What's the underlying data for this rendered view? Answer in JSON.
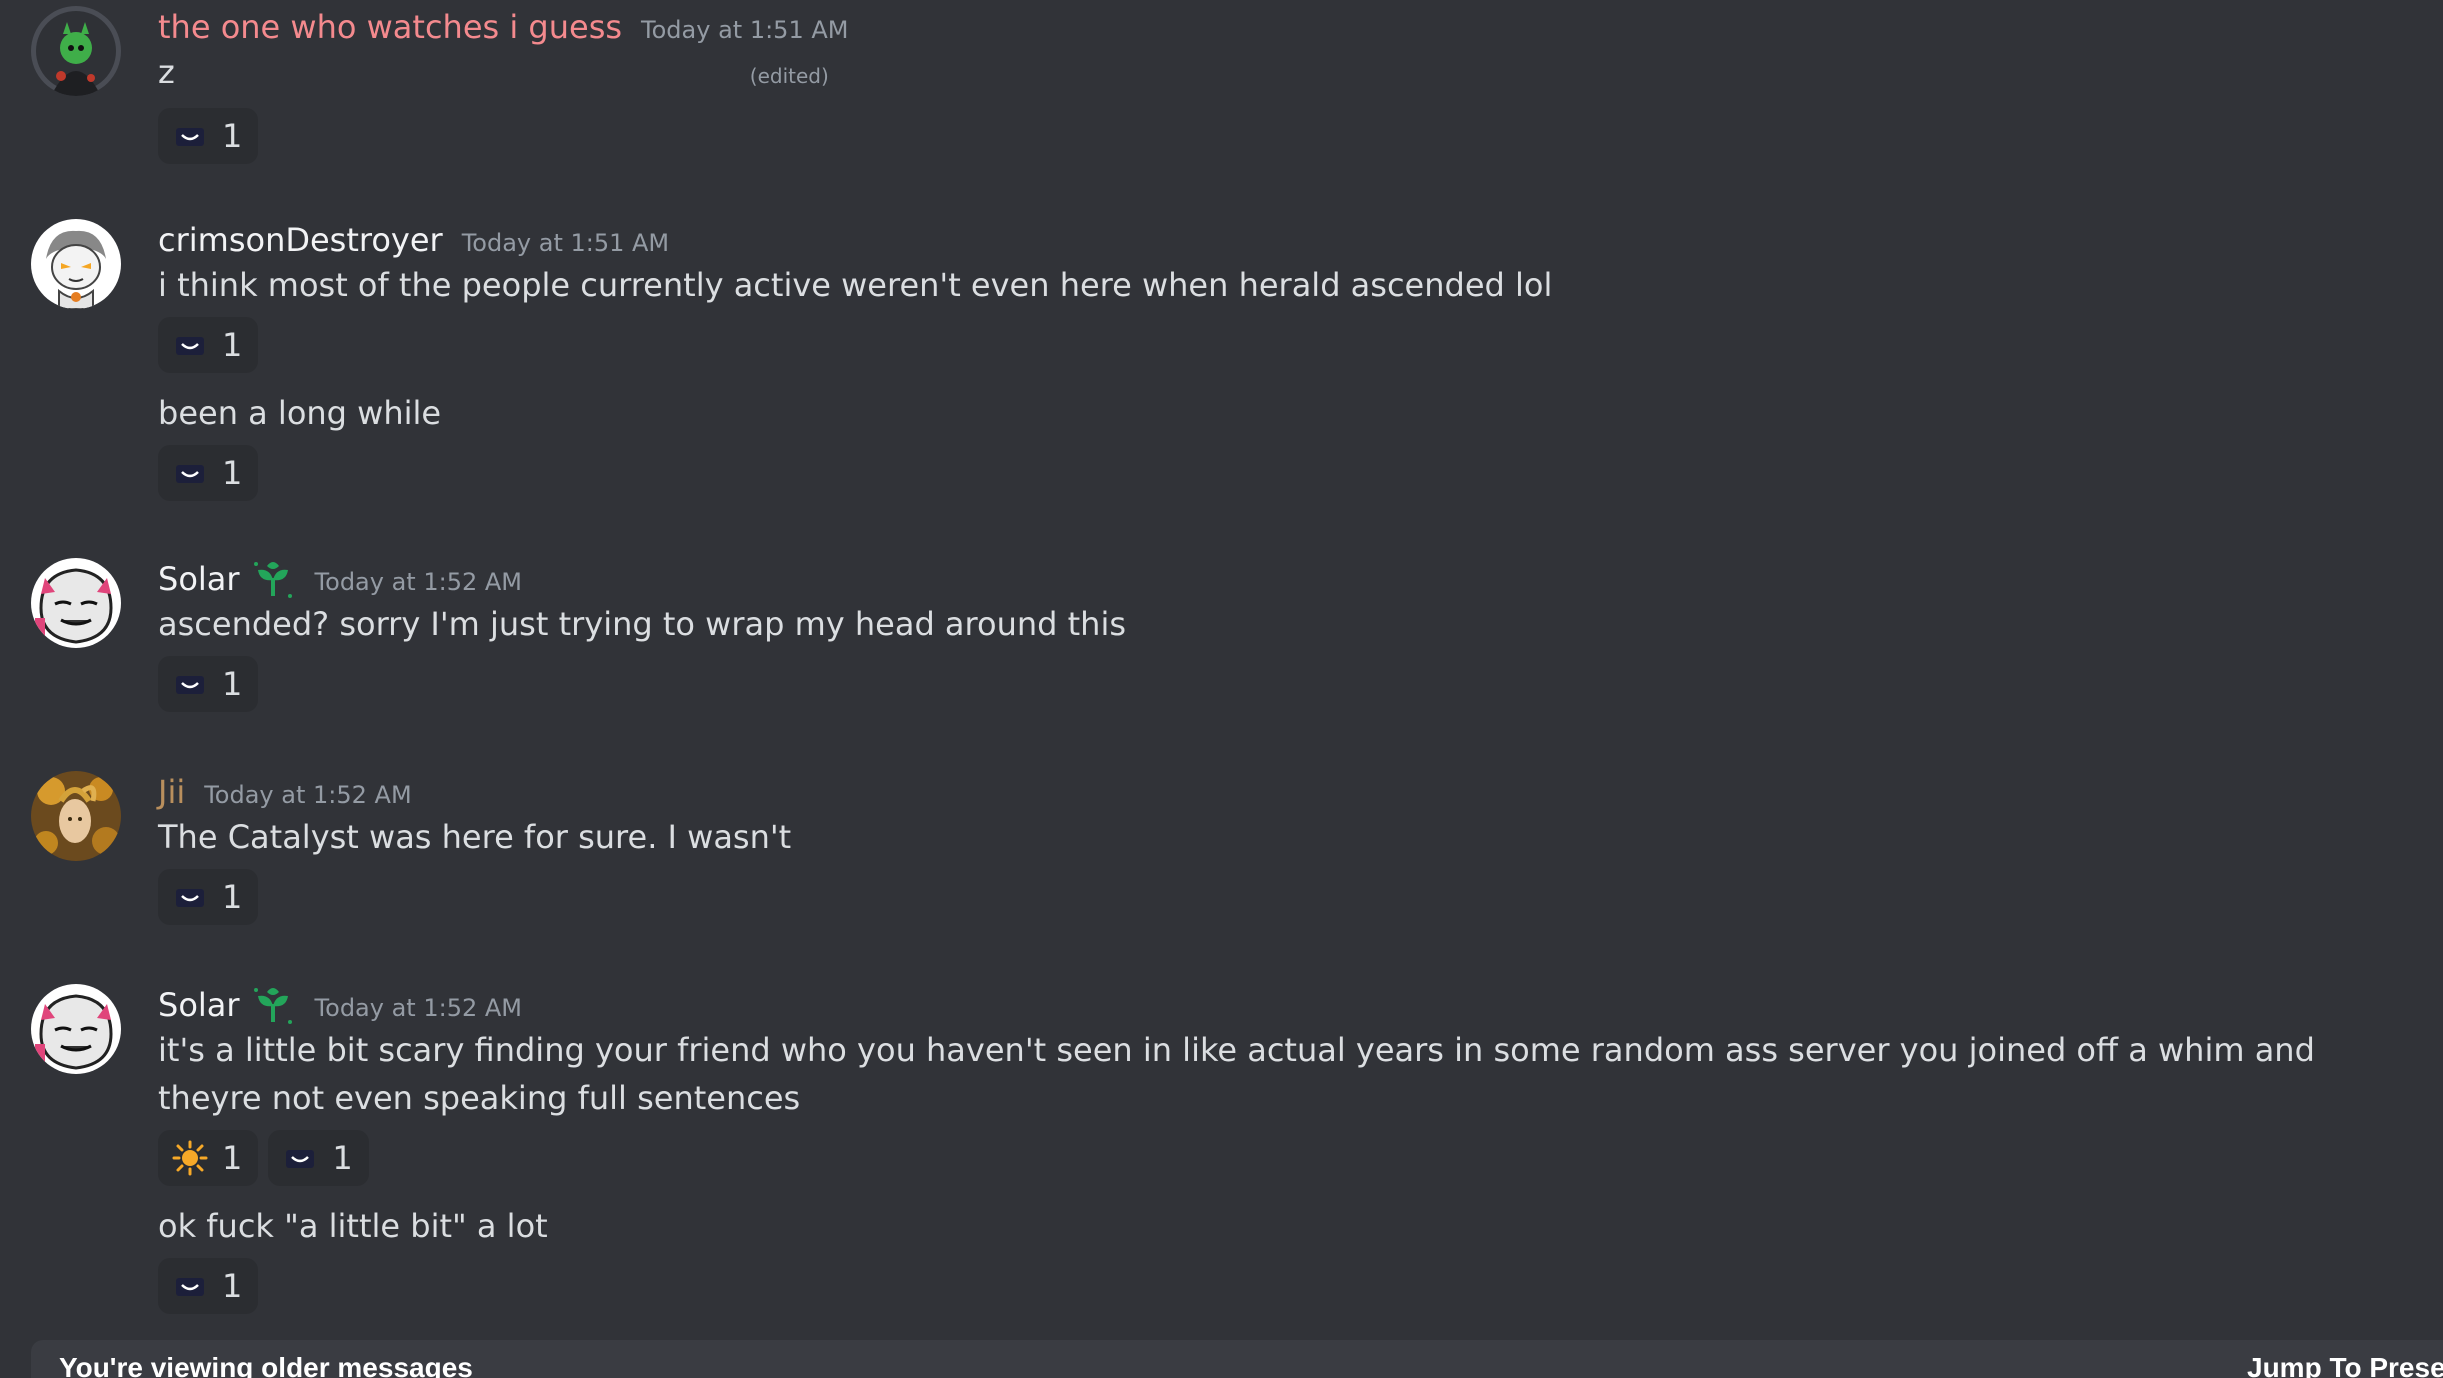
{
  "messages": [
    {
      "username": "the one who watches i guess",
      "username_color": "#f48a8e",
      "timestamp": "Today at 1:51 AM",
      "lines": [
        {
          "text": "z",
          "edited": "(edited)",
          "reactions": [
            {
              "emoji": "dark-eyes-emoji",
              "count": "1"
            }
          ]
        }
      ]
    },
    {
      "username": "crimsonDestroyer",
      "username_color": "#f2f3f5",
      "timestamp": "Today at 1:51 AM",
      "lines": [
        {
          "text": "i think most of the people currently active weren't even here when herald ascended lol",
          "reactions": [
            {
              "emoji": "dark-eyes-emoji",
              "count": "1"
            }
          ]
        },
        {
          "text": "been a long while",
          "reactions": [
            {
              "emoji": "dark-eyes-emoji",
              "count": "1"
            }
          ]
        }
      ]
    },
    {
      "username": "Solar",
      "username_color": "#f2f3f5",
      "badge": "green-sprout-icon",
      "timestamp": "Today at 1:52 AM",
      "lines": [
        {
          "text": "ascended? sorry I'm just trying to wrap my head around this",
          "reactions": [
            {
              "emoji": "dark-eyes-emoji",
              "count": "1"
            }
          ]
        }
      ]
    },
    {
      "username": "Jii",
      "username_color": "#b98f5d",
      "timestamp": "Today at 1:52 AM",
      "lines": [
        {
          "text": "The Catalyst was here for sure. I wasn't",
          "reactions": [
            {
              "emoji": "dark-eyes-emoji",
              "count": "1"
            }
          ]
        }
      ]
    },
    {
      "username": "Solar",
      "username_color": "#f2f3f5",
      "badge": "green-sprout-icon",
      "timestamp": "Today at 1:52 AM",
      "lines": [
        {
          "text": "it's a little bit scary finding your friend who you haven't seen in like actual years in some random ass server you joined off a whim and theyre not even speaking full sentences",
          "reactions": [
            {
              "emoji": "sun-emoji",
              "count": "1"
            },
            {
              "emoji": "dark-eyes-emoji",
              "count": "1"
            }
          ]
        },
        {
          "text": "ok fuck \"a little bit\" a lot",
          "reactions": [
            {
              "emoji": "dark-eyes-emoji",
              "count": "1"
            }
          ]
        }
      ]
    }
  ],
  "older_bar": {
    "text": "You're viewing older messages",
    "jump_label": "Jump To Present"
  },
  "colors": {
    "background": "#313338",
    "reaction_bg": "#2b2d31",
    "timestamp": "#949ba4",
    "accent_green": "#23a55a"
  }
}
